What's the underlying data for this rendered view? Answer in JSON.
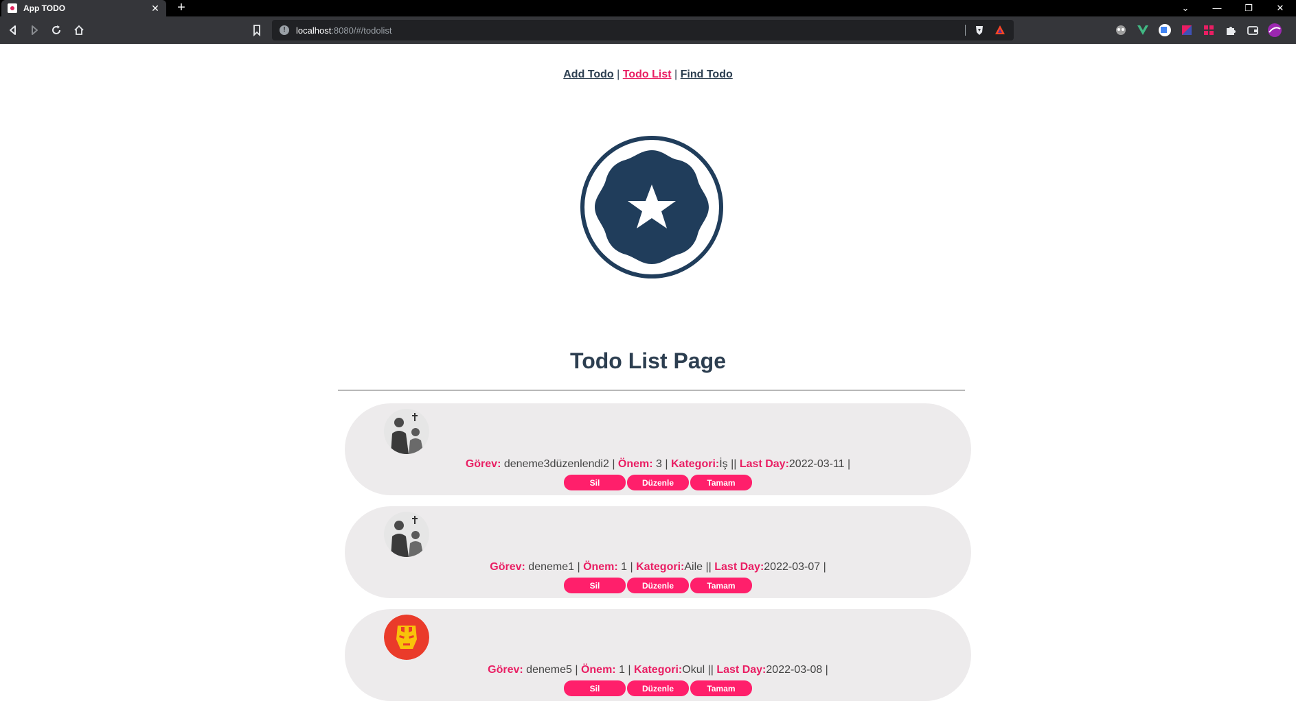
{
  "browser": {
    "tab_title": "App TODO",
    "tab_close": "✕",
    "new_tab": "+",
    "url_host": "localhost",
    "url_path": ":8080/#/todolist",
    "win_minimize": "—",
    "win_restore": "❐",
    "win_close": "✕",
    "tab_list": "⌄"
  },
  "nav": {
    "add": "Add Todo",
    "list": "Todo List",
    "find": "Find Todo",
    "sep": "|"
  },
  "page": {
    "title": "Todo List Page"
  },
  "labels": {
    "gorev": "Görev:",
    "onem": "Önem:",
    "kategori": "Kategori:",
    "lastday": "Last Day:"
  },
  "buttons": {
    "delete": "Sil",
    "edit": "Düzenle",
    "done": "Tamam"
  },
  "todos": [
    {
      "gorev": " deneme3düzenlendi2 | ",
      "onem": " 3 | ",
      "kategori": "İş || ",
      "lastday": "2022-03-11 |",
      "avatar": "family-photo"
    },
    {
      "gorev": " deneme1 | ",
      "onem": " 1 | ",
      "kategori": "Aile || ",
      "lastday": "2022-03-07 |",
      "avatar": "family-photo"
    },
    {
      "gorev": " deneme5 | ",
      "onem": " 1 | ",
      "kategori": "Okul || ",
      "lastday": "2022-03-08 |",
      "avatar": "iron-man"
    }
  ],
  "colors": {
    "accent": "#e91e63",
    "button": "#ff1f6b",
    "text_dark": "#2c3e50",
    "card_bg": "#edebec"
  }
}
